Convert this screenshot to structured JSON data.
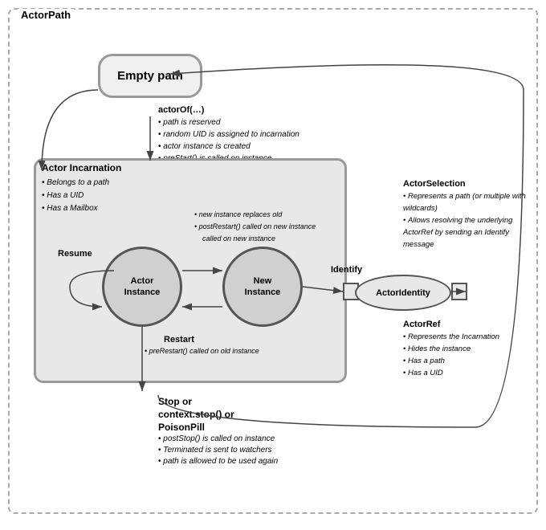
{
  "diagram": {
    "title": "ActorPath",
    "empty_path": "Empty path",
    "actor_incarnation": {
      "label": "Actor Incarnation",
      "properties": [
        "Belongs to a path",
        "Has a UID",
        "Has a Mailbox"
      ]
    },
    "actor_instance": {
      "label": "Actor\nInstance"
    },
    "new_instance": {
      "label": "New\nInstance"
    },
    "actor_identity": {
      "label": "ActorIdentity"
    },
    "actor_of": {
      "title": "actorOf(…)",
      "props": [
        "path is reserved",
        "random UID is assigned to incarnation",
        "actor instance is created",
        "preStart() is called on instance"
      ]
    },
    "resume": {
      "label": "Resume"
    },
    "restart": {
      "label": "Restart",
      "props": [
        "preRestart() called on old instance"
      ]
    },
    "new_instance_props": [
      "new instance replaces old",
      "postRestart() called on new instance"
    ],
    "stop": {
      "title1": "Stop or",
      "title2": "context.stop() or",
      "title3": "PoisonPill",
      "props": [
        "postStop() is called on instance",
        "Terminated is sent to watchers",
        "path is allowed to be used again"
      ]
    },
    "actor_selection": {
      "title": "ActorSelection",
      "props": [
        "Represents a path (or multiple with wildcards)",
        "Allows resolving the underlying ActorRef by sending an Identify message"
      ]
    },
    "actor_ref": {
      "title": "ActorRef",
      "props": [
        "Represents the Incarnation",
        "Hides the instance",
        "Has a path",
        "Has a UID"
      ]
    },
    "identify_label": "Identify"
  }
}
